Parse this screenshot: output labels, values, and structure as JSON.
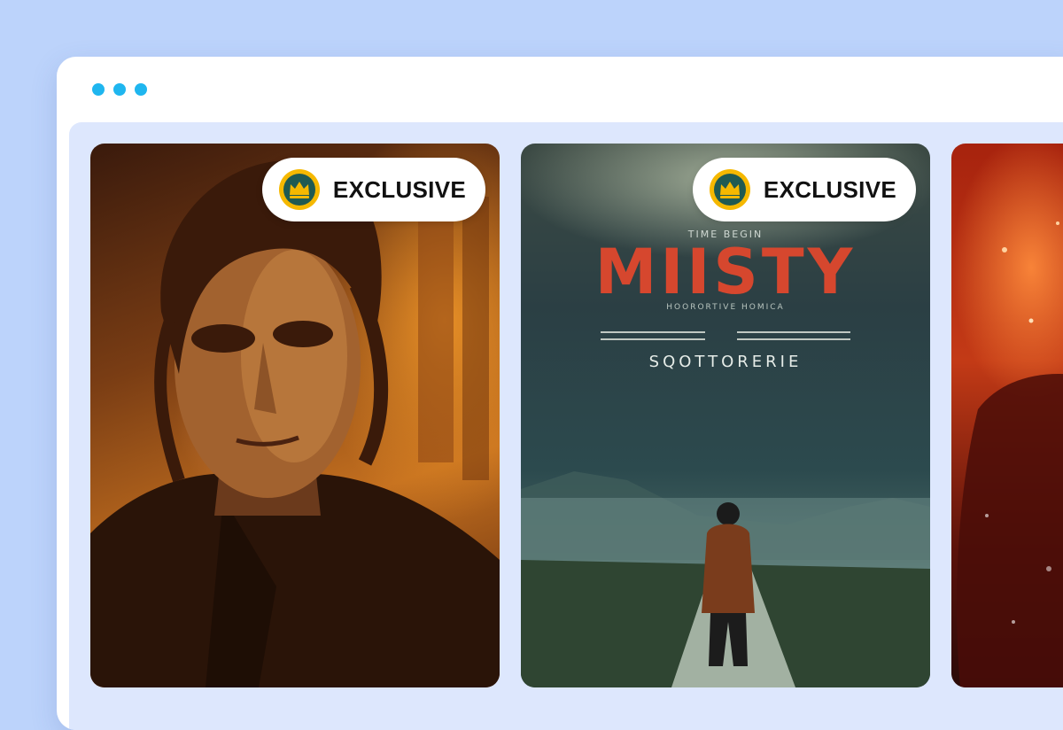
{
  "window": {
    "dots": [
      "dot-1",
      "dot-2",
      "dot-3"
    ],
    "accent": "#1fb6ef"
  },
  "cards": [
    {
      "badge": {
        "label": "EXCLUSIVE",
        "icon": "crown-icon"
      },
      "image": "portrait-poster",
      "palette": [
        "#3a1a0c",
        "#c4701f"
      ]
    },
    {
      "badge": {
        "label": "EXCLUSIVE",
        "icon": "crown-icon"
      },
      "image": "misty-poster",
      "poster": {
        "top_line": "TIME BEGIN",
        "title": "MIISTY",
        "tagline": "HOORORTIVE HOMICA",
        "subtitle": "SQOTTORERIE"
      },
      "palette": [
        "#2b3f44",
        "#d6472e"
      ]
    },
    {
      "image": "fiery-poster",
      "palette": [
        "#a7230e",
        "#2a0b08"
      ]
    }
  ]
}
